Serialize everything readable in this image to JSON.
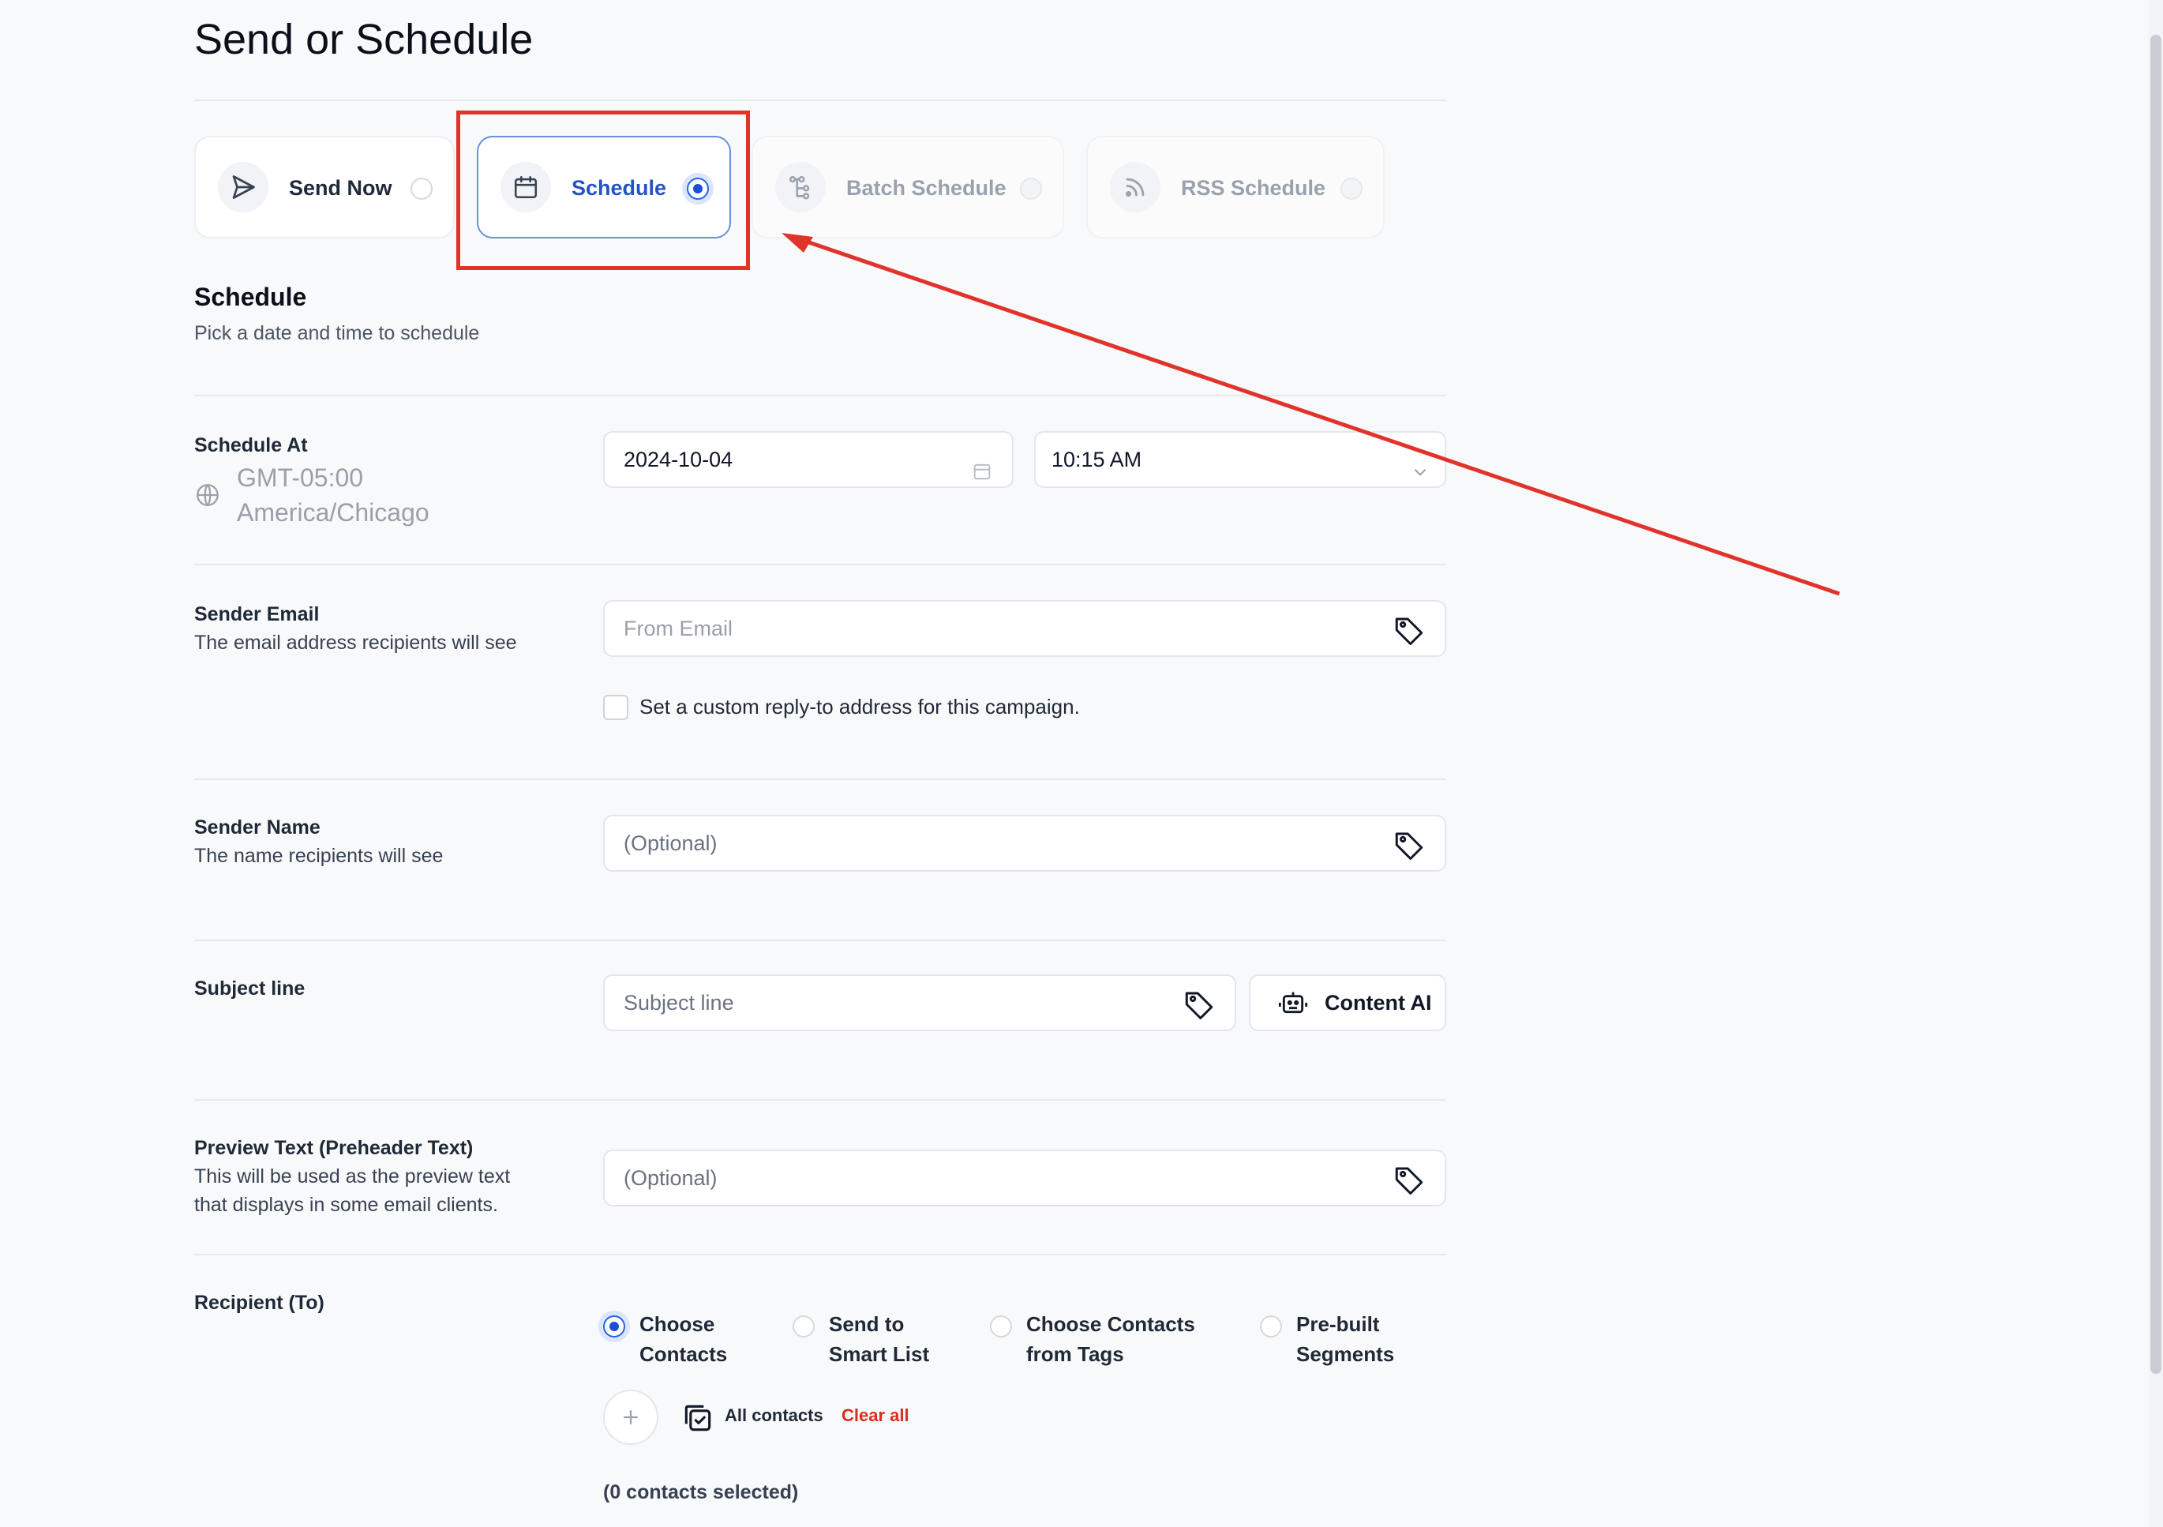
{
  "page": {
    "title": "Send or Schedule"
  },
  "options": [
    {
      "label": "Send Now",
      "selected": false,
      "enabled": true,
      "icon": "send-icon"
    },
    {
      "label": "Schedule",
      "selected": true,
      "enabled": true,
      "icon": "calendar-icon"
    },
    {
      "label": "Batch Schedule",
      "selected": false,
      "enabled": false,
      "icon": "batch-tree-icon"
    },
    {
      "label": "RSS Schedule",
      "selected": false,
      "enabled": false,
      "icon": "rss-icon"
    }
  ],
  "schedule": {
    "title": "Schedule",
    "subtitle": "Pick a date and time to schedule",
    "label": "Schedule At",
    "tz_offset": "GMT-05:00",
    "tz_name": "America/Chicago",
    "date": "2024-10-04",
    "time": "10:15 AM"
  },
  "sender_email": {
    "label": "Sender Email",
    "desc": "The email address recipients will see",
    "placeholder": "From Email",
    "reply_to_label": "Set a custom reply-to address for this campaign."
  },
  "sender_name": {
    "label": "Sender Name",
    "desc": "The name recipients will see",
    "placeholder": "(Optional)"
  },
  "subject": {
    "label": "Subject line",
    "placeholder": "Subject line",
    "ai_button": "Content AI"
  },
  "preview": {
    "label": "Preview Text (Preheader Text)",
    "desc_line1": "This will be used as the preview text",
    "desc_line2": "that displays in some email clients.",
    "placeholder": "(Optional)"
  },
  "recipient": {
    "label": "Recipient (To)",
    "options": [
      {
        "line1": "Choose",
        "line2": "Contacts",
        "selected": true
      },
      {
        "line1": "Send to",
        "line2": "Smart List",
        "selected": false
      },
      {
        "line1": "Choose Contacts",
        "line2": "from Tags",
        "selected": false
      },
      {
        "line1": "Pre-built",
        "line2": "Segments",
        "selected": false
      }
    ],
    "all_contacts": "All contacts",
    "clear_all": "Clear all",
    "count_text": "(0 contacts selected)"
  },
  "colors": {
    "accent": "#2563eb",
    "annotation": "#e0342b",
    "danger_text": "#d92d20"
  }
}
